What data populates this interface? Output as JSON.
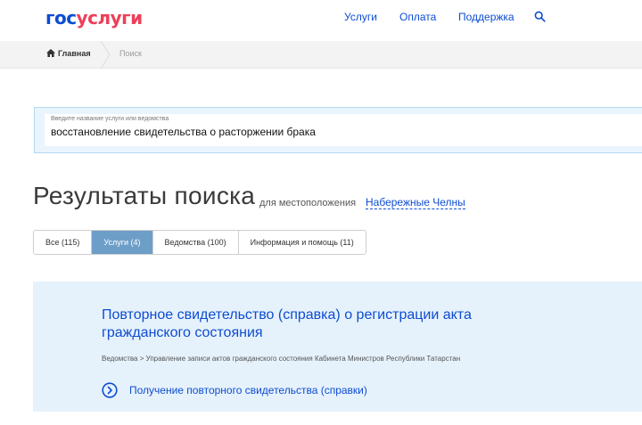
{
  "header": {
    "logo_part1": "гос",
    "logo_part2": "услуги",
    "nav": [
      "Услуги",
      "Оплата",
      "Поддержка"
    ],
    "search_icon": "search-icon"
  },
  "breadcrumb": {
    "home": "Главная",
    "current": "Поиск"
  },
  "search": {
    "label": "Введите название услуги или ведомства",
    "value": "восстановление свидетельства о расторжении брака"
  },
  "results": {
    "title": "Результаты поиска",
    "location_label": "для местоположения",
    "location": "Набережные Челны"
  },
  "tabs": [
    {
      "label": "Все (115)",
      "active": false
    },
    {
      "label": "Услуги (4)",
      "active": true
    },
    {
      "label": "Ведомства (100)",
      "active": false
    },
    {
      "label": "Информация и помощь (11)",
      "active": false
    }
  ],
  "result_card": {
    "title": "Повторное свидетельство (справка) о регистрации акта гражданского состояния",
    "path": "Ведомства > Управление записи актов гражданского состояния Кабинета Министров Республики Татарстан",
    "link": "Получение повторного свидетельства (справки)"
  },
  "colors": {
    "brand_blue": "#0d4cd3",
    "brand_red": "#ee3f58",
    "active_tab": "#6d9ec8",
    "card_bg": "#e6f2fb"
  }
}
